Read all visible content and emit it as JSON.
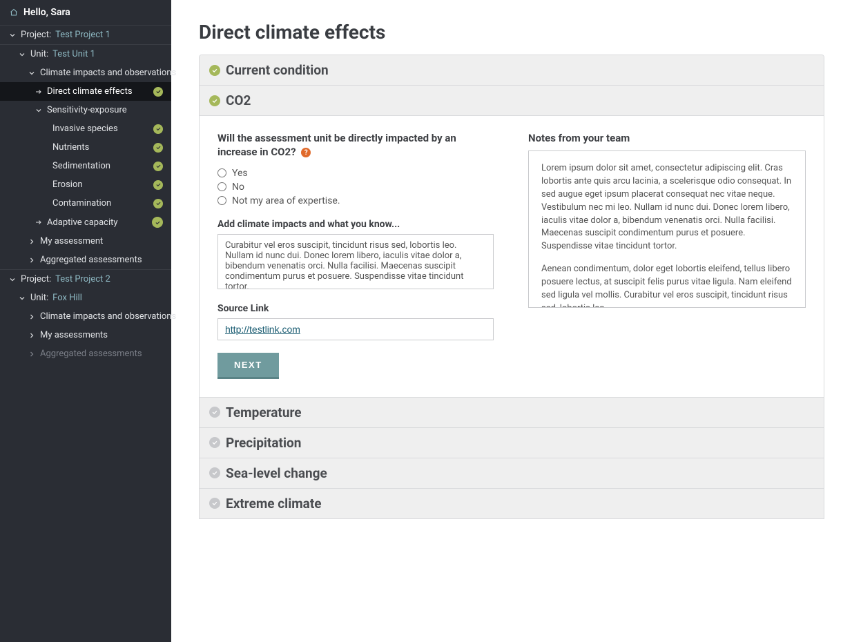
{
  "greeting": "Hello, Sara",
  "sidebar": {
    "project1": {
      "label": "Project:",
      "name": "Test Project 1"
    },
    "unit1": {
      "label": "Unit:",
      "name": "Test Unit 1"
    },
    "cio": "Climate impacts and observations",
    "direct": "Direct climate effects",
    "sens": "Sensitivity-exposure",
    "sens_items": {
      "invasive": "Invasive species",
      "nutrients": "Nutrients",
      "sedimentation": "Sedimentation",
      "erosion": "Erosion",
      "contamination": "Contamination"
    },
    "adaptive": "Adaptive capacity",
    "my_assessment": "My assessment",
    "aggregated": "Aggregated assessments",
    "project2": {
      "label": "Project:",
      "name": "Test Project 2"
    },
    "unit2": {
      "label": "Unit:",
      "name": "Fox Hill"
    },
    "cio2": "Climate impacts and observations",
    "my_assessments": "My assessments",
    "aggregated2": "Aggregated assessments"
  },
  "page": {
    "title": "Direct climate effects",
    "sections": {
      "current": "Current condition",
      "co2": "CO2",
      "temperature": "Temperature",
      "precipitation": "Precipitation",
      "sealevel": "Sea-level change",
      "extreme": "Extreme climate"
    }
  },
  "co2_form": {
    "question": "Will the assessment unit be directly impacted by an increase in CO2?",
    "help": "?",
    "opt_yes": "Yes",
    "opt_no": "No",
    "opt_na": "Not my area of expertise.",
    "impacts_label": "Add climate impacts and what you know...",
    "impacts_value": "Curabitur vel eros suscipit, tincidunt risus sed, lobortis leo. Nullam id nunc dui. Donec lorem libero, iaculis vitae dolor a, bibendum venenatis orci. Nulla facilisi. Maecenas suscipit condimentum purus et posuere. Suspendisse vitae tincidunt tortor.",
    "source_label": "Source Link",
    "source_value": "http://testlink.com",
    "next": "NEXT"
  },
  "notes": {
    "title": "Notes from your team",
    "p1": "Lorem ipsum dolor sit amet, consectetur adipiscing elit. Cras lobortis ante quis arcu lacinia, a scelerisque odio consequat. In sed augue eget ipsum placerat consequat nec vitae neque. Vestibulum nec mi leo. Nullam id nunc dui. Donec lorem libero, iaculis vitae dolor a, bibendum venenatis orci. Nulla facilisi. Maecenas suscipit condimentum purus et posuere. Suspendisse vitae tincidunt tortor.",
    "p2": "Aenean condimentum, dolor eget lobortis eleifend, tellus libero posuere lectus, at suscipit felis purus vitae ligula. Nam eleifend sed ligula vel mollis. Curabitur vel eros suscipit, tincidunt risus sed, lobortis leo"
  }
}
